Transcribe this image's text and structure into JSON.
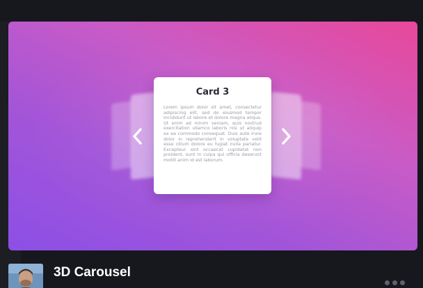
{
  "carousel": {
    "active_card": {
      "title": "Card 3",
      "body": "Lorem ipsum dolor sit amet, consectetur adipiscing elit, sed do eiusmod tempor incididunt ut labore et dolore magna aliqua. Ut enim ad minim veniam, quis nostrud exercitation ullamco laboris nisi ut aliquip ex ea commodo consequat. Duis aute irure dolor in reprehenderit in voluptate velit esse cillum dolore eu fugiat nulla pariatur. Excepteur sint occaecat cupidatat non proident, sunt in culpa qui officia deserunt mollit anim id est laborum."
    },
    "prev_icon": "chevron-left-icon",
    "next_icon": "chevron-right-icon",
    "background_colors": [
      "#e8489a",
      "#c95bc6",
      "#8c4fe6"
    ]
  },
  "footer": {
    "project_title": "3D Carousel",
    "menu_icon": "more-dots-icon"
  }
}
